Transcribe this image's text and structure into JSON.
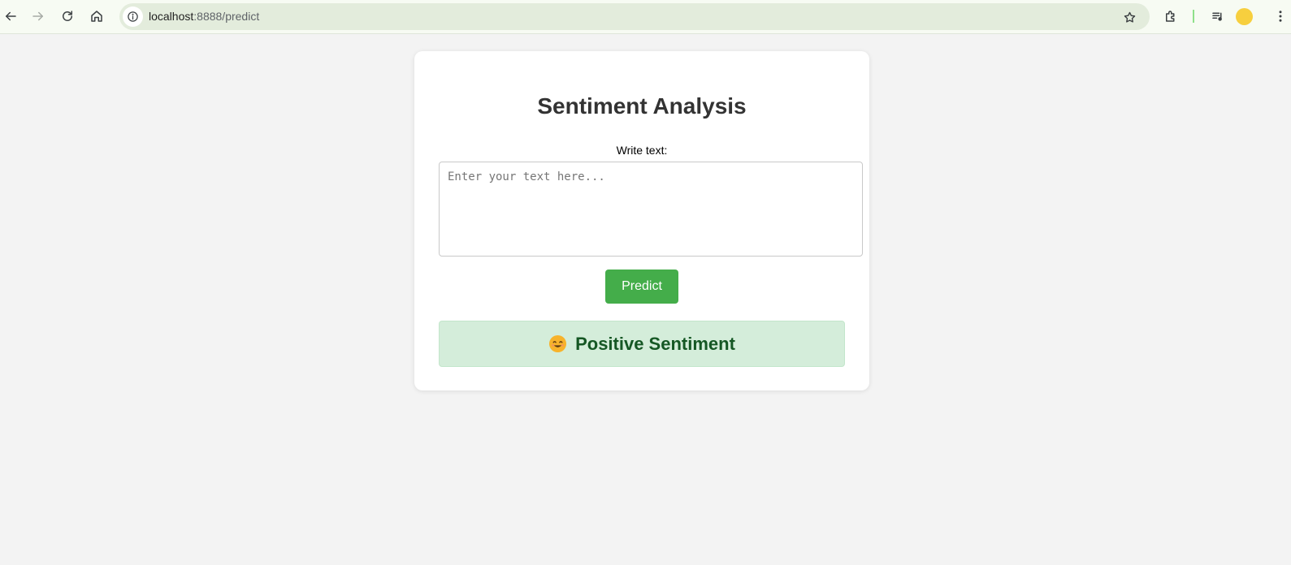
{
  "browser": {
    "url_host": "localhost",
    "url_path": ":8888/predict",
    "icons": [
      "back-icon",
      "forward-icon",
      "reload-icon",
      "home-icon",
      "info-icon",
      "bookmark-star-icon",
      "extensions-icon",
      "media-icon",
      "profile-avatar",
      "menu-icon"
    ],
    "avatar_color": "#f7cf3e"
  },
  "page": {
    "title": "Sentiment Analysis",
    "input_label": "Write text:",
    "input_placeholder": "Enter your text here...",
    "input_value": "",
    "predict_label": "Predict",
    "result": {
      "icon": "smiling-face-emoji",
      "text": "Positive Sentiment",
      "sentiment": "positive"
    }
  },
  "colors": {
    "accent_button": "#44ad4a",
    "result_background": "#d4edda",
    "result_text": "#155724",
    "page_background": "#f3f3f3"
  }
}
